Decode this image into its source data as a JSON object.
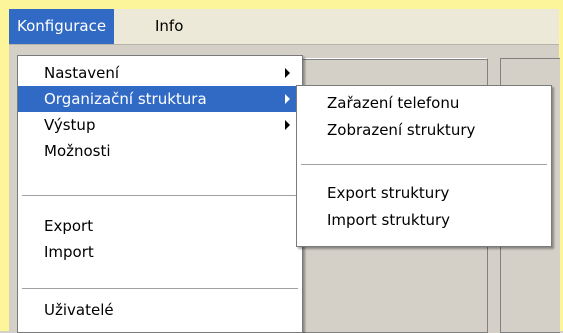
{
  "menubar": {
    "items": [
      {
        "label": "Konfigurace"
      },
      {
        "label": "Info"
      }
    ]
  },
  "menu": {
    "items": [
      {
        "label": "Nastavení"
      },
      {
        "label": "Organizační struktura"
      },
      {
        "label": "Výstup"
      },
      {
        "label": "Možnosti"
      },
      {
        "label": "Export"
      },
      {
        "label": "Import"
      },
      {
        "label": "Uživatelé"
      }
    ]
  },
  "submenu": {
    "items": [
      {
        "label": "Zařazení telefonu"
      },
      {
        "label": "Zobrazení struktury"
      },
      {
        "label": "Export struktury"
      },
      {
        "label": "Import struktury"
      }
    ]
  },
  "colors": {
    "highlight": "#316ac5",
    "frame": "#fdf59a",
    "menubar": "#ece9d8",
    "window": "#d4d0c8"
  }
}
